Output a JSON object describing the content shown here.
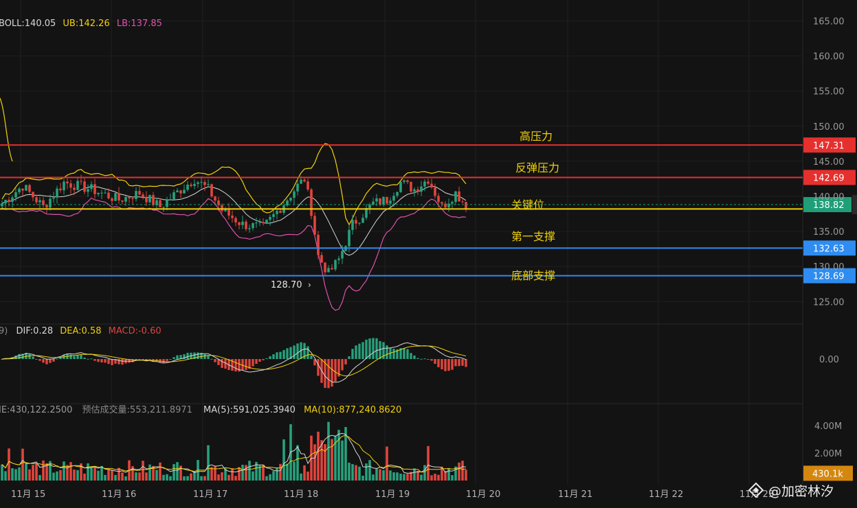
{
  "chart_data": {
    "type": "candlestick",
    "x_ticks": [
      "11月 15",
      "11月 16",
      "11月 17",
      "11月 18",
      "11月 19",
      "11月 20",
      "11月 21",
      "11月 22",
      "11月 23"
    ],
    "price_axis": {
      "ylim": [
        122,
        167
      ],
      "ticks": [
        "165.00",
        "160.00",
        "155.00",
        "150.00",
        "145.00",
        "140.00",
        "135.00",
        "130.00",
        "125.00"
      ]
    },
    "boll": {
      "label": "BOLL:140.05",
      "ub": "UB:142.26",
      "lb": "LB:137.85"
    },
    "levels": [
      {
        "name": "高压力",
        "value": 147.31,
        "badge": "147.31",
        "color": "#e5302e"
      },
      {
        "name": "反弹压力",
        "value": 142.69,
        "badge": "142.69",
        "color": "#e5302e"
      },
      {
        "name": "关键位",
        "value": 138.2,
        "badge": "",
        "color": "#f2d20a"
      },
      {
        "name": "第一支撑",
        "value": 132.63,
        "badge": "132.63",
        "color": "#2f8cf0"
      },
      {
        "name": "底部支撑",
        "value": 128.69,
        "badge": "128.69",
        "color": "#2f8cf0"
      }
    ],
    "current_price": {
      "value": 138.82,
      "label": "138.82",
      "color": "#1f9e78"
    },
    "low_annotation": {
      "value": 128.7,
      "label": "128.70"
    },
    "macd": {
      "prefix": "9)",
      "dif": "DIF:0.28",
      "dea": "DEA:0.58",
      "macd": "MACD:-0.60",
      "zero_tick": "0.00"
    },
    "volume": {
      "vol": "IE:430,122.2500",
      "est": "预估成交量:553,211.8971",
      "ma5": "MA(5):591,025.3940",
      "ma10": "MA(10):877,240.8620",
      "ticks": [
        "4.00M",
        "2.00M"
      ],
      "current": "430.1k",
      "ylim": [
        0,
        4.5
      ]
    },
    "grid": true
  },
  "watermark": {
    "text": "@加密林汐"
  },
  "colors": {
    "up": "#27a17c",
    "down": "#e0453c",
    "mid": "#d8d8d8",
    "upper": "#f2d20a",
    "lower": "#e052b0",
    "bg": "#131313"
  }
}
